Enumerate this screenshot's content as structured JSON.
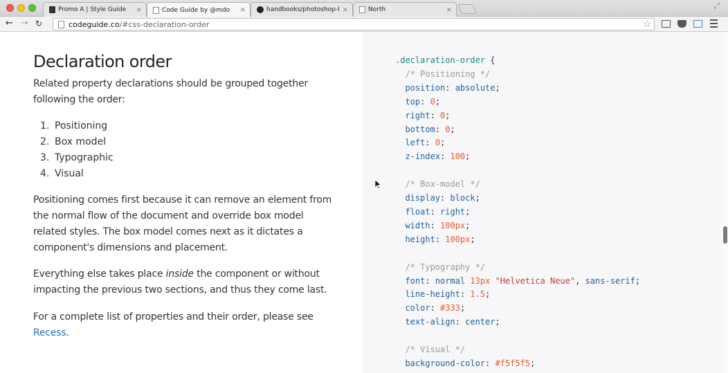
{
  "browser": {
    "tabs": [
      {
        "title": "Promo A | Style Guide",
        "favicon": "bootstrap-icon"
      },
      {
        "title": "Code Guide by @mdo",
        "favicon": "page-icon"
      },
      {
        "title": "handbooks/photoshop-h",
        "favicon": "github-icon"
      },
      {
        "title": "North",
        "favicon": "page-icon"
      }
    ],
    "active_tab": 1,
    "tab_close": "×",
    "url_host": "codeguide.co",
    "url_path": "/#css-declaration-order"
  },
  "doc": {
    "heading": "Declaration order",
    "intro": "Related property declarations should be grouped together following the order:",
    "order_items": [
      {
        "num": "1.",
        "label": "Positioning"
      },
      {
        "num": "2.",
        "label": "Box model"
      },
      {
        "num": "3.",
        "label": "Typographic"
      },
      {
        "num": "4.",
        "label": "Visual"
      }
    ],
    "para_positioning": "Positioning comes first because it can remove an element from the normal flow of the document and override box model related styles. The box model comes next as it dictates a component's dimensions and placement.",
    "para_else_before": "Everything else takes place ",
    "para_else_em": "inside",
    "para_else_after": " the component or without impacting the previous two sections, and thus they come last.",
    "para_list": "For a complete list of properties and their order, please see ",
    "recess_link": "Recess",
    "recess_period": "."
  },
  "code": {
    "selector": ".declaration-order",
    "lines": [
      ".declaration-order {",
      "  /* Positioning */",
      "  position: absolute;",
      "  top: 0;",
      "  right: 0;",
      "  bottom: 0;",
      "  left: 0;",
      "  z-index: 100;",
      "",
      "  /* Box-model */",
      "  display: block;",
      "  float: right;",
      "  width: 100px;",
      "  height: 100px;",
      "",
      "  /* Typography */",
      "  font: normal 13px \"Helvetica Neue\", sans-serif;",
      "  line-height: 1.5;",
      "  color: #333;",
      "  text-align: center;",
      "",
      "  /* Visual */",
      "  background-color: #f5f5f5;"
    ]
  },
  "colors": {
    "link": "#1f74b5",
    "code_selector": "#22867a",
    "code_property": "#235f9c",
    "code_number": "#e8592a",
    "code_string": "#cd3b36",
    "code_comment": "#999999",
    "code_bg": "#f7f7f9"
  }
}
